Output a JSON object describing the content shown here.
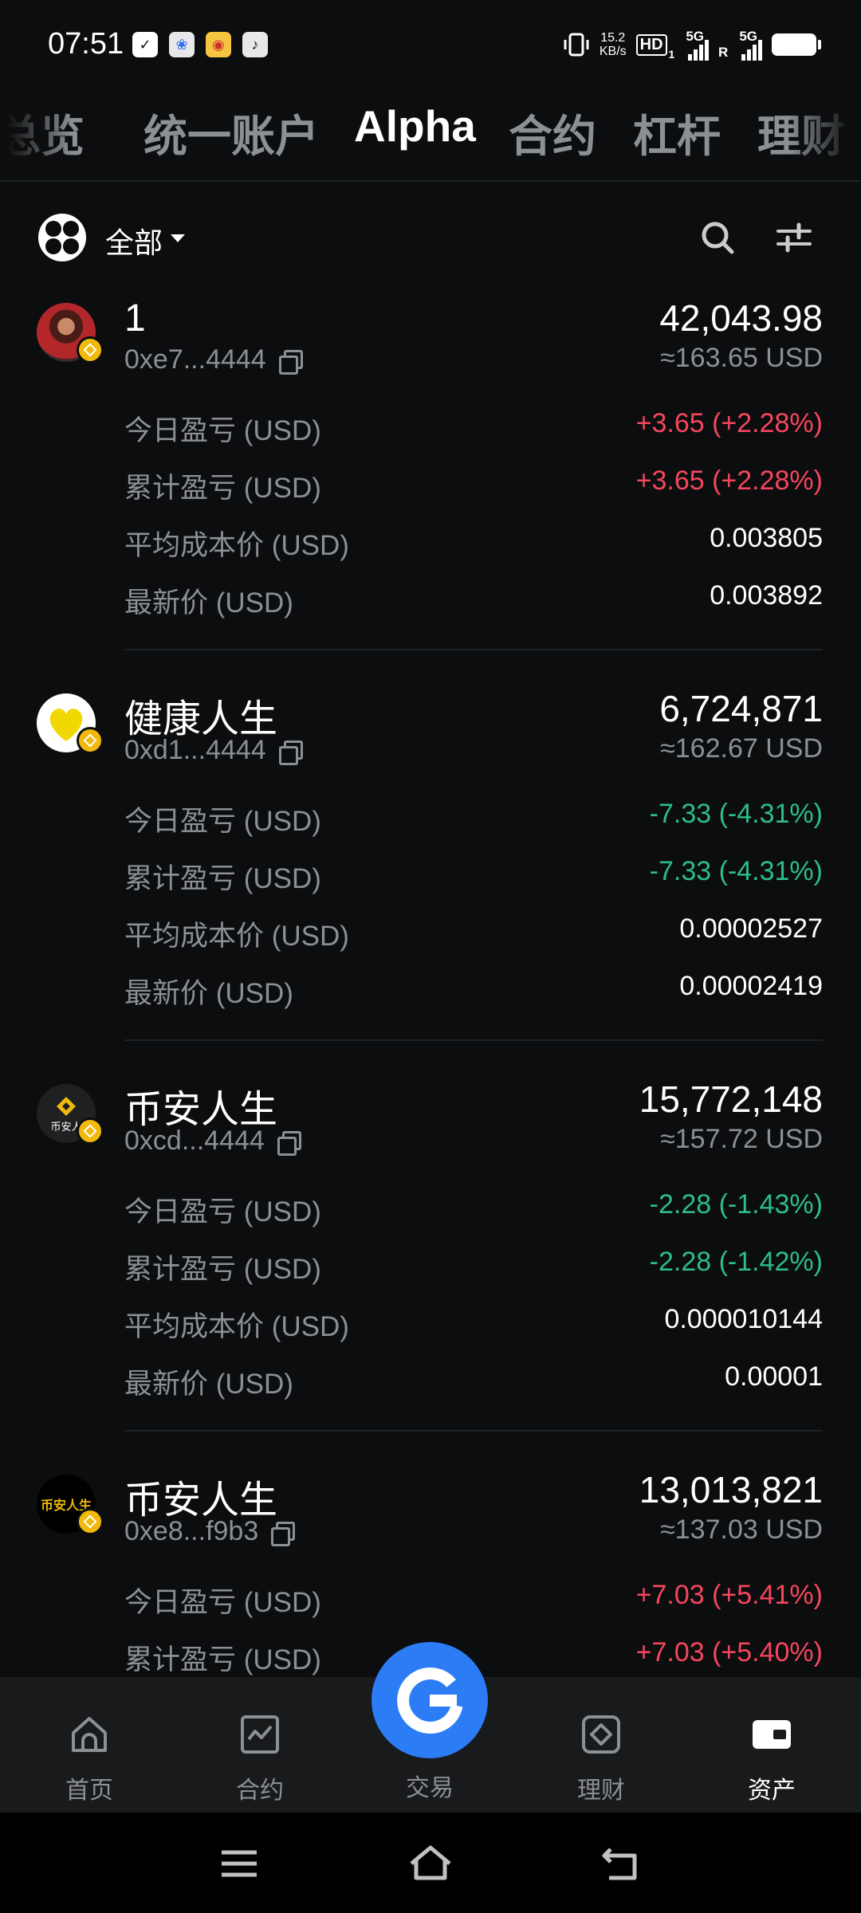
{
  "status_bar": {
    "time": "07:51",
    "speed_value": "15.2",
    "speed_unit": "KB/s",
    "hd_label": "HD",
    "hd_sub": "1",
    "net1": "5G",
    "net2": "5G",
    "roaming": "R"
  },
  "tabs": [
    "总览",
    "统一账户",
    "Alpha",
    "合约",
    "杠杆",
    "理财"
  ],
  "active_tab": "Alpha",
  "filter": {
    "label": "全部"
  },
  "assets": [
    {
      "name": "1",
      "address": "0xe7...4444",
      "amount": "42,043.98",
      "usd": "≈163.65 USD",
      "rows": [
        {
          "label": "今日盈亏 (USD)",
          "value": "+3.65 (+2.28%)",
          "trend": "up"
        },
        {
          "label": "累计盈亏 (USD)",
          "value": "+3.65 (+2.28%)",
          "trend": "up"
        },
        {
          "label": "平均成本价 (USD)",
          "value": "0.003805",
          "trend": "none"
        },
        {
          "label": "最新价 (USD)",
          "value": "0.003892",
          "trend": "none"
        }
      ]
    },
    {
      "name": "健康人生",
      "address": "0xd1...4444",
      "amount": "6,724,871",
      "usd": "≈162.67 USD",
      "rows": [
        {
          "label": "今日盈亏 (USD)",
          "value": "-7.33 (-4.31%)",
          "trend": "down"
        },
        {
          "label": "累计盈亏 (USD)",
          "value": "-7.33 (-4.31%)",
          "trend": "down"
        },
        {
          "label": "平均成本价 (USD)",
          "value": "0.00002527",
          "trend": "none"
        },
        {
          "label": "最新价 (USD)",
          "value": "0.00002419",
          "trend": "none"
        }
      ]
    },
    {
      "name": "币安人生",
      "address": "0xcd...4444",
      "amount": "15,772,148",
      "usd": "≈157.72 USD",
      "avatar_text": "币安人",
      "rows": [
        {
          "label": "今日盈亏 (USD)",
          "value": "-2.28 (-1.43%)",
          "trend": "down"
        },
        {
          "label": "累计盈亏 (USD)",
          "value": "-2.28 (-1.42%)",
          "trend": "down"
        },
        {
          "label": "平均成本价 (USD)",
          "value": "0.000010144",
          "trend": "none"
        },
        {
          "label": "最新价 (USD)",
          "value": "0.00001",
          "trend": "none"
        }
      ]
    },
    {
      "name": "币安人生",
      "address": "0xe8...f9b3",
      "amount": "13,013,821",
      "usd": "≈137.03 USD",
      "avatar_text": "币安人生",
      "rows": [
        {
          "label": "今日盈亏 (USD)",
          "value": "+7.03 (+5.41%)",
          "trend": "up"
        },
        {
          "label": "累计盈亏 (USD)",
          "value": "+7.03 (+5.40%)",
          "trend": "up"
        }
      ]
    }
  ],
  "bottom_nav": [
    {
      "label": "首页",
      "icon": "home-icon"
    },
    {
      "label": "合约",
      "icon": "futures-chart-icon"
    },
    {
      "label": "交易",
      "icon": "trade-icon"
    },
    {
      "label": "理财",
      "icon": "earn-icon"
    },
    {
      "label": "资产",
      "icon": "wallet-icon"
    }
  ],
  "active_nav": "资产",
  "colors": {
    "up": "#f6465d",
    "down": "#2ebd85",
    "accent": "#2c7cf5",
    "badge": "#f0b90b"
  }
}
